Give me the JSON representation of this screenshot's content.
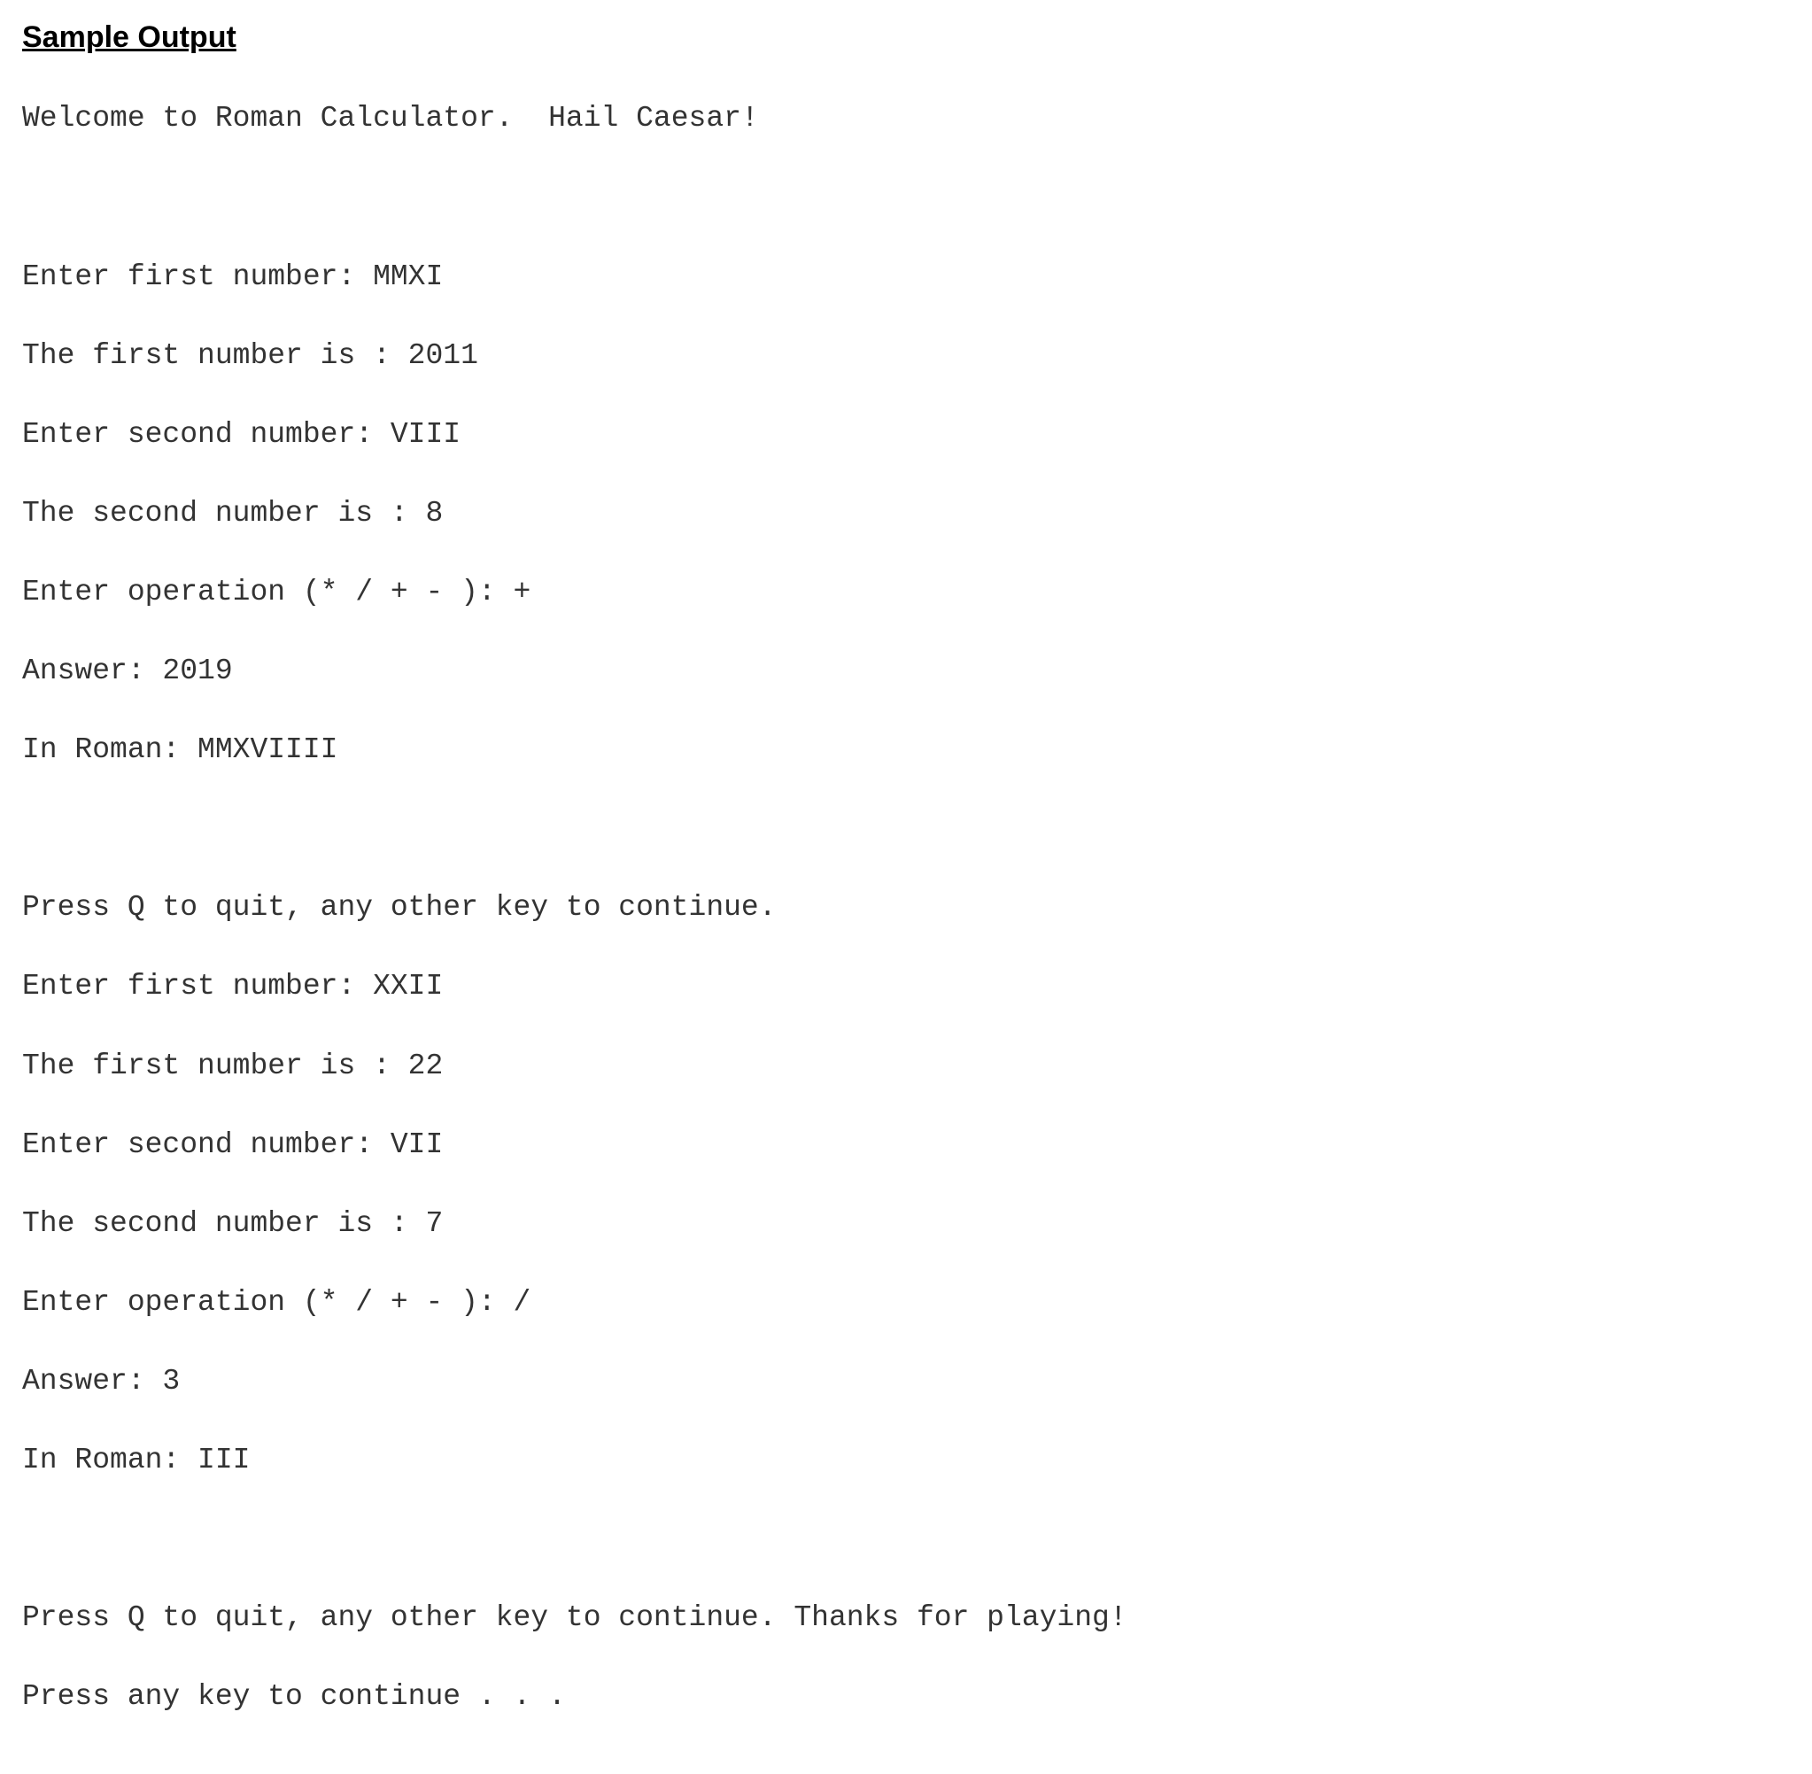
{
  "heading": "Sample Output",
  "lines": {
    "welcome": "Welcome to Roman Calculator.  Hail Caesar!",
    "blank1": "",
    "p1_first_prompt": "Enter first number: MMXI",
    "p1_first_value": "The first number is : 2011",
    "p1_second_prompt": "Enter second number: VIII",
    "p1_second_value": "The second number is : 8",
    "p1_op": "Enter operation (* / + - ): +",
    "p1_answer": "Answer: 2019",
    "p1_roman": "In Roman: MMXVIIII",
    "blank2": "",
    "p2_continue": "Press Q to quit, any other key to continue.",
    "p2_first_prompt": "Enter first number: XXII",
    "p2_first_value": "The first number is : 22",
    "p2_second_prompt": "Enter second number: VII",
    "p2_second_value": "The second number is : 7",
    "p2_op": "Enter operation (* / + - ): /",
    "p2_answer": "Answer: 3",
    "p2_roman": "In Roman: III",
    "blank3": "",
    "end_thanks": "Press Q to quit, any other key to continue. Thanks for playing!",
    "end_press": "Press any key to continue . . ."
  }
}
